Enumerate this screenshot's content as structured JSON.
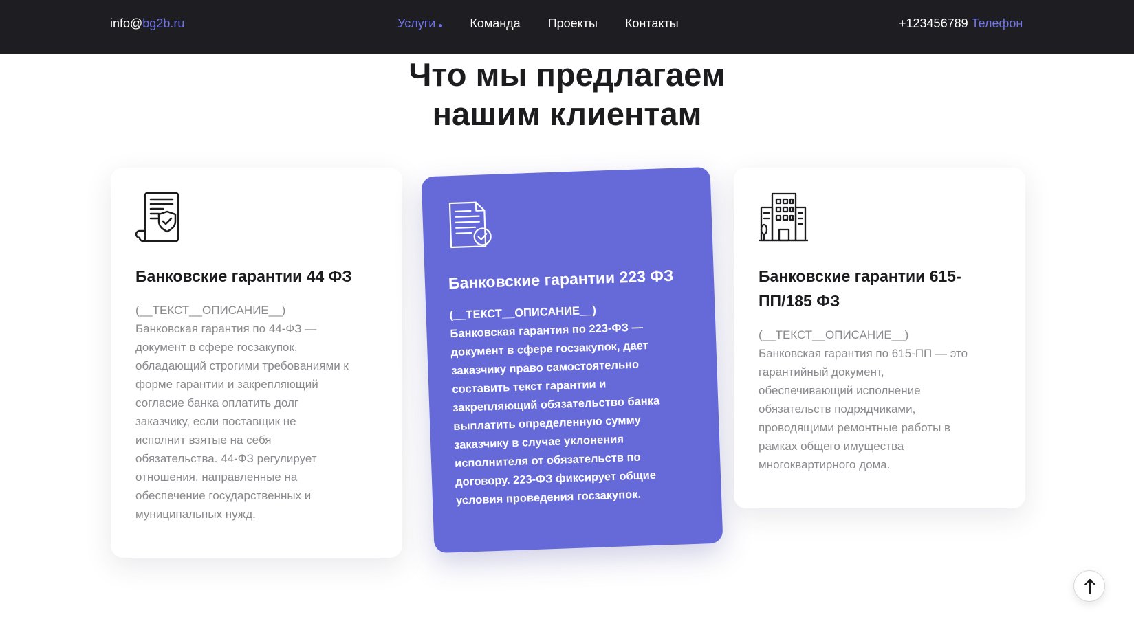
{
  "header": {
    "email_user": "info@",
    "email_domain": "bg2b.ru",
    "nav": [
      {
        "label": "Услуги",
        "active": true
      },
      {
        "label": "Команда",
        "active": false
      },
      {
        "label": "Проекты",
        "active": false
      },
      {
        "label": "Контакты",
        "active": false
      }
    ],
    "phone_number": "+123456789",
    "phone_label": "Телефон"
  },
  "section": {
    "title_line1": "Что мы предлагаем",
    "title_line2": "нашим клиентам"
  },
  "cards": [
    {
      "icon": "document-shield-icon",
      "title": "Банковские гарантии 44 ФЗ",
      "text_lines": [
        "(__ТЕКСТ__ОПИСАНИЕ__)",
        "Банковская гарантия по 44-ФЗ —",
        "документ в сфере госзакупок,",
        "обладающий строгими требованиями к",
        "форме гарантии и закрепляющий",
        "согласие банка оплатить долг",
        "заказчику, если поставщик не",
        "исполнит взятые на себя",
        "обязательства. 44-ФЗ регулирует",
        "отношения, направленные на",
        "обеспечение государственных и",
        "муниципальных нужд."
      ]
    },
    {
      "icon": "document-check-icon",
      "title": "Банковские гарантии 223 ФЗ",
      "text_lines": [
        "(__ТЕКСТ__ОПИСАНИЕ__)",
        "Банковская гарантия по 223-ФЗ —",
        "документ в сфере госзакупок, дает",
        "заказчику право самостоятельно",
        "составить текст гарантии и",
        "закрепляющий обязательство банка",
        "выплатить определенную сумму",
        "заказчику в случае уклонения",
        "исполнителя от обязательств по",
        "договору. 223-ФЗ фиксирует общие",
        "условия проведения госзакупок."
      ]
    },
    {
      "icon": "buildings-icon",
      "title_line1": "Банковские гарантии 615-",
      "title_line2": "ПП/185 ФЗ",
      "text_lines": [
        "(__ТЕКСТ__ОПИСАНИЕ__)",
        "Банковская гарантия по 615-ПП — это",
        "гарантийный документ,",
        "обеспечивающий исполнение",
        "обязательств подрядчиками,",
        "проводящими ремонтные работы в",
        "рамках общего имущества",
        "многоквартирного дома."
      ]
    }
  ],
  "scroll_top": {
    "icon": "arrow-up-icon"
  },
  "colors": {
    "header_bg": "#1e1e22",
    "accent": "#6f74e6",
    "card_highlight": "#666ad9",
    "muted_text": "#8a8a8e"
  }
}
